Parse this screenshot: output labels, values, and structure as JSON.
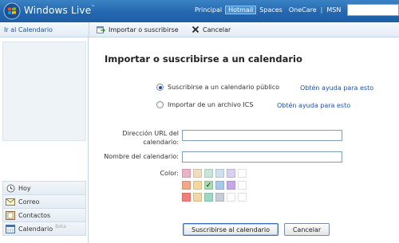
{
  "header": {
    "brand": "Windows Live",
    "brand_tm": "™",
    "nav": [
      {
        "label": "Principal",
        "active": false
      },
      {
        "label": "Hotmail",
        "active": true
      },
      {
        "label": "Spaces",
        "active": false
      },
      {
        "label": "OneCare",
        "active": false
      },
      {
        "label": "MSN",
        "active": false
      }
    ],
    "nav_separator": "|"
  },
  "subbar": {
    "left_link": "Ir al Calendario",
    "import_label": "Importar o suscribirse",
    "cancel_label": "Cancelar"
  },
  "sidebar": {
    "items": [
      {
        "label": "Hoy",
        "icon": "clock-icon"
      },
      {
        "label": "Correo",
        "icon": "envelope-icon"
      },
      {
        "label": "Contactos",
        "icon": "contacts-icon"
      },
      {
        "label": "Calendario",
        "icon": "calendar-icon",
        "badge": "Beta"
      }
    ]
  },
  "main": {
    "title": "Importar o suscribirse a un calendario",
    "options": [
      {
        "label": "Suscribirse a un calendario público",
        "selected": true,
        "help": "Obtén ayuda para esto"
      },
      {
        "label": "Importar de un archivo ICS",
        "selected": false,
        "help": "Obtén ayuda para esto"
      }
    ],
    "url_label_line1": "Dirección URL del",
    "url_label_line2": "calendario:",
    "url_value": "",
    "name_label": "Nombre del calendario:",
    "name_value": "",
    "color_label": "Color:",
    "colors": [
      "#e8b4c8",
      "#f0dcc0",
      "#c6e6dc",
      "#cfe0ef",
      "#d8d0ee",
      "#ffffff",
      "#f0a888",
      "#f5d89c",
      "#a8dcb0",
      "#a8c8e8",
      "#c4a8e8",
      "#ffffff",
      "#f08078",
      "#f0d8a8",
      "#9ed8c4",
      "#c8ccd4",
      "#ffffff",
      "#ffffff"
    ],
    "selected_color_index": 8,
    "check_mark": "✓",
    "subscribe_button": "Suscribirse al calendario",
    "cancel_button": "Cancelar"
  }
}
